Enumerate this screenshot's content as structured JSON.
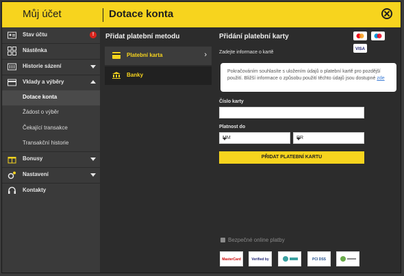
{
  "header": {
    "account_title": "Můj účet",
    "page_title": "Dotace konta"
  },
  "sidebar": {
    "items": [
      {
        "label": "Stav účtu",
        "alert": "!"
      },
      {
        "label": "Nástěnka"
      },
      {
        "label": "Historie sázení"
      },
      {
        "label": "Vklady a výběry"
      }
    ],
    "subitems": [
      {
        "label": "Dotace konta",
        "active": true
      },
      {
        "label": "Žádost o výběr"
      },
      {
        "label": "Čekající transakce"
      },
      {
        "label": "Transakční historie"
      }
    ],
    "more_items": [
      {
        "label": "Bonusy"
      },
      {
        "label": "Nastavení"
      },
      {
        "label": "Kontakty"
      }
    ]
  },
  "methods": {
    "heading": "Přidat platební metodu",
    "items": [
      {
        "label": "Platební karta",
        "active": true
      },
      {
        "label": "Banky"
      }
    ]
  },
  "form": {
    "heading": "Přidání platební karty",
    "card_brands": [
      "mastercard-icon",
      "maestro-icon",
      "VISA"
    ],
    "subtitle": "Zadejte informace o kartě",
    "consent_text": "Pokračováním souhlasíte s uložením údajů o platební kartě pro pozdější použití. Bližší informace o způsobu použití těchto údajů jsou dostupné ",
    "consent_link": "zde",
    "card_number_label": "Číslo karty",
    "card_number_value": "",
    "expiry_label": "Platnost do",
    "month_value": "MM",
    "year_value": "RR",
    "submit_label": "PŘIDAT PLATEBNÍ KARTU",
    "secure_text": "Bezpečné online platby",
    "logos": [
      "MasterCard SecureCode",
      "Verified by VISA",
      "",
      "PCI DSS",
      ""
    ]
  },
  "colors": {
    "accent": "#f7d41e",
    "panel": "#2c2c2c",
    "sidebar": "#3a3a3a",
    "alert": "#d9231c"
  }
}
